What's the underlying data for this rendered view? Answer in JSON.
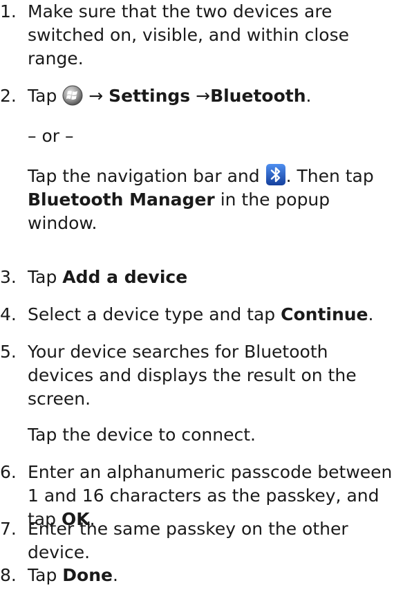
{
  "steps": [
    {
      "number": "1.",
      "text": "Make sure that the two devices are switched on, visible, and within close range."
    },
    {
      "number": "2.",
      "prefix": "Tap",
      "icon_start": "windows-start-icon",
      "arrow1": "→",
      "bold1": "Settings",
      "arrow2": "→",
      "bold2": "Bluetooth",
      "suffix": "."
    },
    {
      "or_text": "– or –"
    },
    {
      "alt_prefix": "Tap the navigation bar and",
      "icon_bt": "bluetooth-icon",
      "alt_mid": ". Then tap",
      "alt_bold": "Bluetooth Manager",
      "alt_suffix": "in the popup window."
    },
    {
      "number": "3.",
      "prefix": "Tap",
      "bold": "Add a device"
    },
    {
      "number": "4.",
      "prefix": "Select a device type and tap",
      "bold": "Continue",
      "suffix": "."
    },
    {
      "number": "5.",
      "text": "Your device searches for Bluetooth devices and displays the result on the screen.",
      "sub": "Tap the device to connect."
    },
    {
      "number": "6.",
      "prefix": "Enter an alphanumeric passcode between 1 and 16 characters as the passkey, and tap",
      "bold": "OK",
      "suffix": "."
    },
    {
      "number": "7.",
      "text": "Enter the same passkey on the other device."
    },
    {
      "number": "8.",
      "prefix": "Tap",
      "bold": "Done",
      "suffix": "."
    }
  ],
  "colors": {
    "text": "#1a1a1a",
    "bt_blue": "#1d5fd6"
  }
}
